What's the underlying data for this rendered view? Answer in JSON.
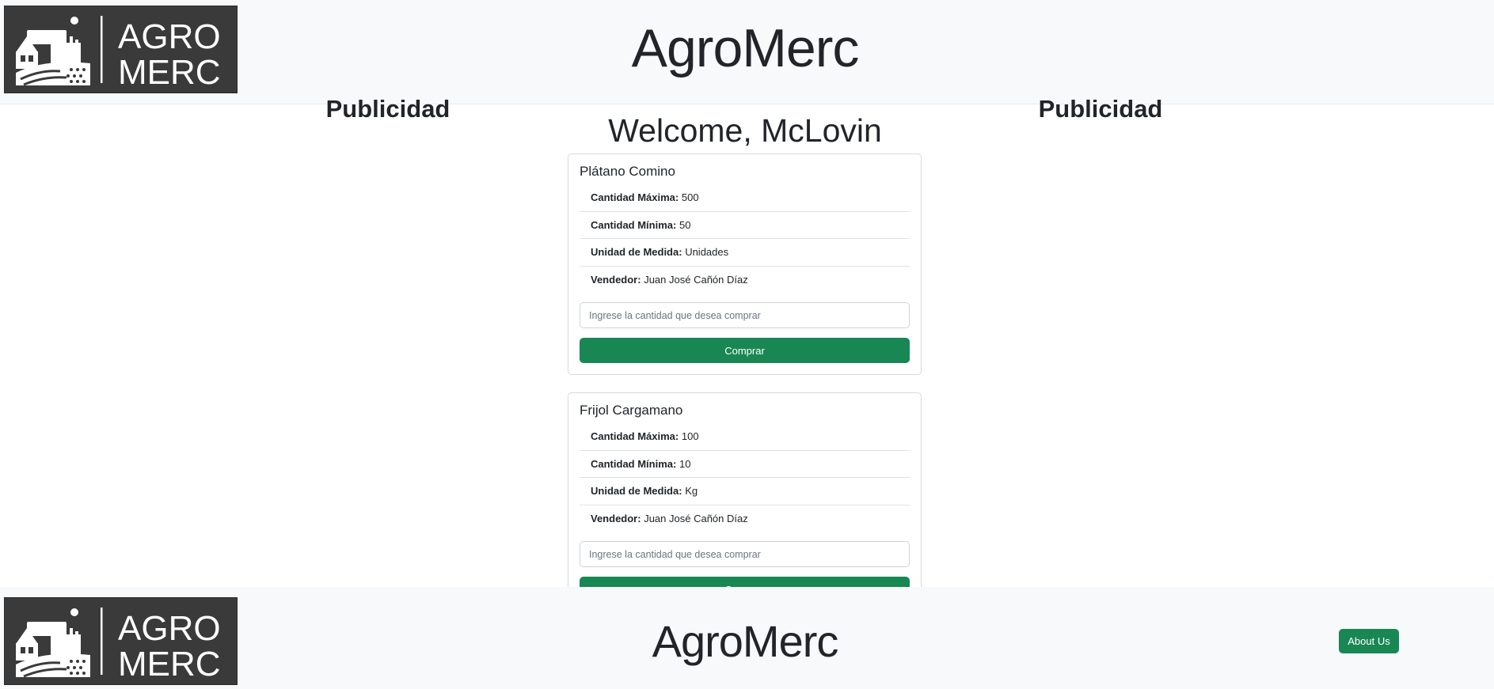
{
  "header": {
    "logo_text": [
      "AGRO",
      "MERC"
    ],
    "title": "AgroMerc"
  },
  "ads": {
    "left": "Publicidad",
    "right": "Publicidad"
  },
  "welcome": "Welcome, McLovin",
  "products": [
    {
      "name": "Plátano Comino",
      "rows": [
        {
          "label": "Cantidad Máxima:",
          "value": "500"
        },
        {
          "label": "Cantidad Mínima:",
          "value": "50"
        },
        {
          "label": "Unidad de Medida:",
          "value": "Unidades"
        },
        {
          "label": "Vendedor:",
          "value": "Juan José Cañón Díaz"
        }
      ],
      "input_placeholder": "Ingrese la cantidad que desea comprar",
      "button": "Comprar"
    },
    {
      "name": "Frijol Cargamano",
      "rows": [
        {
          "label": "Cantidad Máxima:",
          "value": "100"
        },
        {
          "label": "Cantidad Mínima:",
          "value": "10"
        },
        {
          "label": "Unidad de Medida:",
          "value": "Kg"
        },
        {
          "label": "Vendedor:",
          "value": "Juan José Cañón Díaz"
        }
      ],
      "input_placeholder": "Ingrese la cantidad que desea comprar",
      "button": "Comprar"
    }
  ],
  "footer": {
    "title": "AgroMerc",
    "about_button": "About Us"
  },
  "colors": {
    "accent": "#198754",
    "header_bg": "#f8f9fa",
    "logo_bg": "#3a3a3a"
  }
}
